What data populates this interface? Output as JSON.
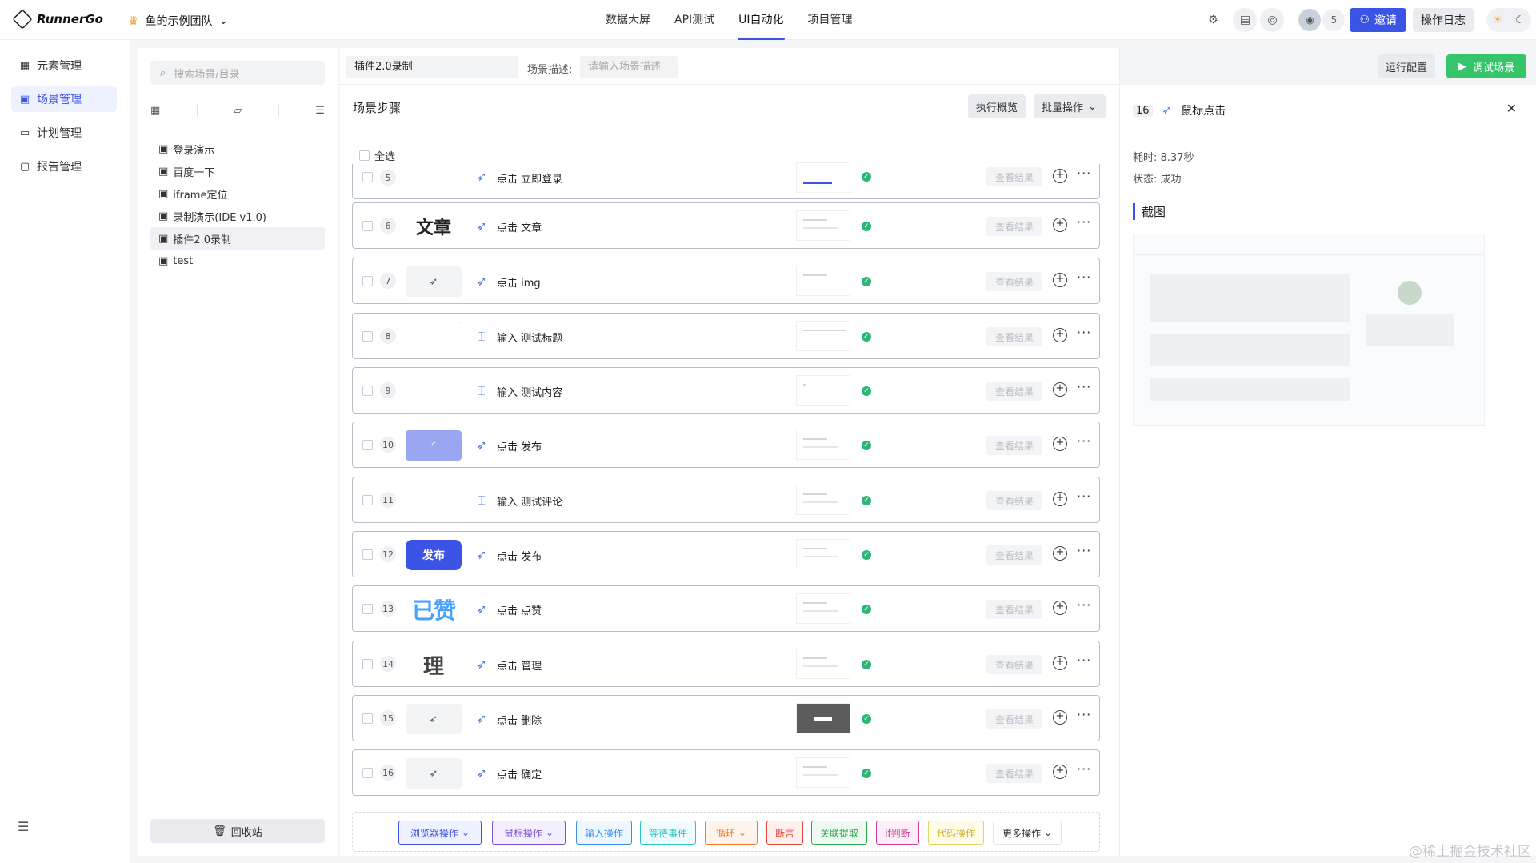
{
  "header": {
    "brand": "RunnerGo",
    "team": "鱼的示例团队",
    "nav": [
      {
        "label": "数据大屏",
        "active": false
      },
      {
        "label": "API测试",
        "active": false
      },
      {
        "label": "UI自动化",
        "active": true
      },
      {
        "label": "项目管理",
        "active": false
      }
    ],
    "member_count": "5",
    "invite_label": "邀请",
    "oplog_label": "操作日志"
  },
  "leftnav": [
    {
      "label": "元素管理",
      "icon": "grid-icon",
      "active": false
    },
    {
      "label": "场景管理",
      "icon": "scene-icon",
      "active": true
    },
    {
      "label": "计划管理",
      "icon": "calendar-icon",
      "active": false
    },
    {
      "label": "报告管理",
      "icon": "report-icon",
      "active": false
    }
  ],
  "tree": {
    "search_placeholder": "搜索场景/目录",
    "nodes": [
      "登录演示",
      "百度一下",
      "iframe定位",
      "录制演示(IDE v1.0)",
      "插件2.0录制",
      "test"
    ],
    "selected": "插件2.0录制",
    "recycle_label": "回收站"
  },
  "scene": {
    "name": "插件2.0录制",
    "desc_label": "场景描述:",
    "desc_placeholder": "请输入场景描述",
    "run_config_label": "运行配置",
    "debug_label": "调试场景",
    "steps_title": "场景步骤",
    "exec_overview_label": "执行概览",
    "batch_label": "批量操作",
    "select_all_label": "全选",
    "view_result_label": "查看结果"
  },
  "steps": [
    {
      "no": "5",
      "thumb": "",
      "type": "click",
      "name": "点击 立即登录"
    },
    {
      "no": "6",
      "thumb": "文章",
      "type": "click",
      "name": "点击 文章"
    },
    {
      "no": "7",
      "thumb": "",
      "type": "click",
      "name": "点击 img"
    },
    {
      "no": "8",
      "thumb": "",
      "type": "input",
      "name": "输入 测试标题"
    },
    {
      "no": "9",
      "thumb": "",
      "type": "input",
      "name": "输入 测试内容"
    },
    {
      "no": "10",
      "thumb": "",
      "type": "click",
      "name": "点击 发布"
    },
    {
      "no": "11",
      "thumb": "",
      "type": "input",
      "name": "输入 测试评论"
    },
    {
      "no": "12",
      "thumb": "发布",
      "type": "click",
      "name": "点击 发布"
    },
    {
      "no": "13",
      "thumb": "已赞",
      "type": "click",
      "name": "点击 点赞"
    },
    {
      "no": "14",
      "thumb": "理",
      "type": "click",
      "name": "点击 管理"
    },
    {
      "no": "15",
      "thumb": "",
      "type": "click",
      "name": "点击 删除"
    },
    {
      "no": "16",
      "thumb": "",
      "type": "click",
      "name": "点击 确定"
    }
  ],
  "add_actions": [
    {
      "label": "浏览器操作",
      "dropdown": true,
      "color": "#3c54e6"
    },
    {
      "label": "鼠标操作",
      "dropdown": true,
      "color": "#7b4fd1"
    },
    {
      "label": "输入操作",
      "dropdown": false,
      "color": "#3b8ee6"
    },
    {
      "label": "等待事件",
      "dropdown": false,
      "color": "#2fc1c9"
    },
    {
      "label": "循环",
      "dropdown": true,
      "color": "#f07a2e"
    },
    {
      "label": "断言",
      "dropdown": false,
      "color": "#e0473d"
    },
    {
      "label": "关联提取",
      "dropdown": false,
      "color": "#2fa84f"
    },
    {
      "label": "if判断",
      "dropdown": false,
      "color": "#d1399c"
    },
    {
      "label": "代码操作",
      "dropdown": false,
      "color": "#c9b22a"
    },
    {
      "label": "更多操作",
      "dropdown": true,
      "color": "#333333"
    }
  ],
  "detail": {
    "step_no": "16",
    "title": "鼠标点击",
    "duration_label": "耗时:",
    "duration": "8.37秒",
    "status_label": "状态:",
    "status": "成功",
    "screenshot_label": "截图"
  },
  "watermark": "@稀土掘金技术社区"
}
